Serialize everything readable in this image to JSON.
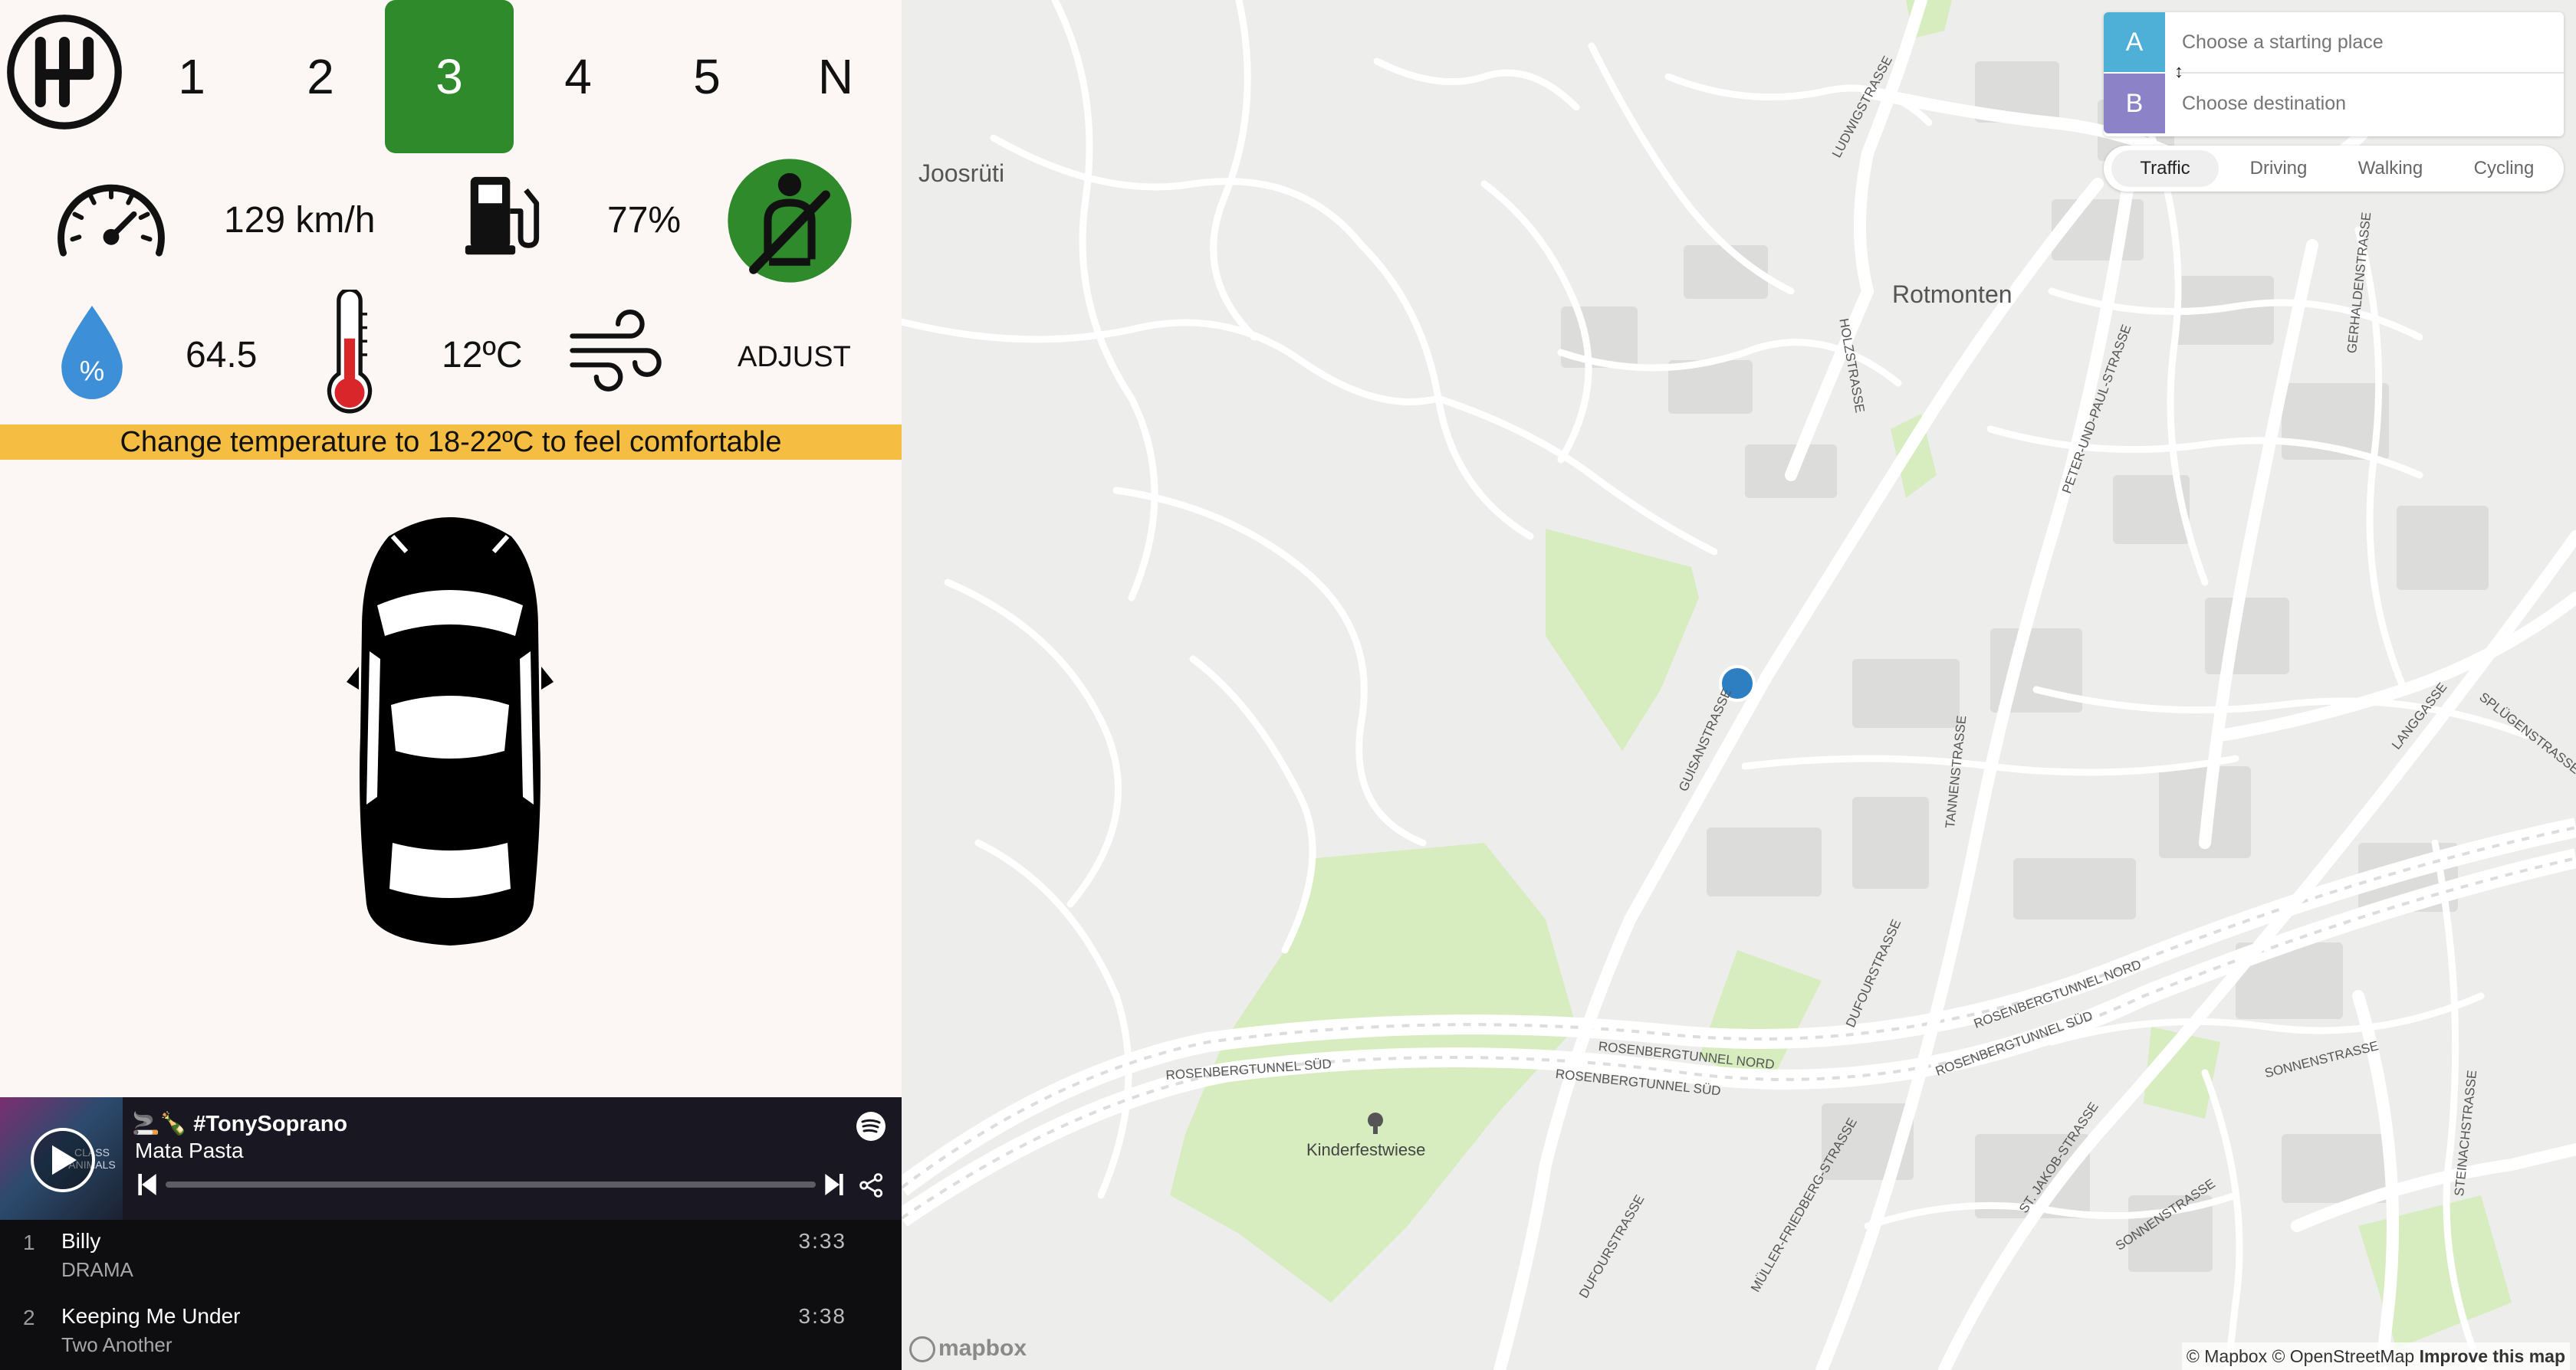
{
  "dashboard": {
    "gears": [
      "1",
      "2",
      "3",
      "4",
      "5",
      "N"
    ],
    "active_gear": "3",
    "speed": "129 km/h",
    "fuel": "77%",
    "humidity": "64.5",
    "humidity_symbol": "%",
    "temperature": "12ºC",
    "fan_action": "ADJUST",
    "banner": "Change temperature to 18-22ºC to feel comfortable",
    "colors": {
      "accent_green": "#2e8a2a",
      "banner_yellow": "#f5be42",
      "water_blue": "#3d8fd8",
      "thermo_red": "#d8262b"
    }
  },
  "player": {
    "artist": "#TonySopranо",
    "artist_emoji": "🚬🍾",
    "song": "Mata Pasta",
    "album_art_text": "CLASS ANIMALS",
    "tracks": [
      {
        "num": "1",
        "title": "Billy",
        "artist": "DRAMA",
        "duration": "3:33"
      },
      {
        "num": "2",
        "title": "Keeping Me Under",
        "artist": "Two Another",
        "duration": "3:38"
      }
    ]
  },
  "map": {
    "directions": {
      "a_label": "A",
      "b_label": "B",
      "origin_placeholder": "Choose a starting place",
      "destination_placeholder": "Choose destination",
      "swap_icon": "↕"
    },
    "profiles": [
      "Traffic",
      "Driving",
      "Walking",
      "Cycling"
    ],
    "active_profile": "Traffic",
    "labels": {
      "joosruti": "Joosrüti",
      "rotmonten": "Rotmonten",
      "kinderfestwiese": "Kinderfestwiese",
      "ludwigstrasse": "LUDWIGSTRASSE",
      "holzstrasse": "HOLZSTRASSE",
      "guisanstrasse": "GUISANSTRASSE",
      "tannenstrasse": "TANNENSTRASSE",
      "peter_paul": "PETER-UND-PAUL-STRASSE",
      "gerhaldenstrasse": "GERHALDENSTRASSE",
      "langgasse": "LANGGASSE",
      "splugenstrasse": "SPLÜGENSTRASSE",
      "dufourstrasse": "DUFOURSTRASSE",
      "dufourstrasse2": "DUFOURSTRASSE",
      "rosen_sud1": "ROSENBERGTUNNEL SÜD",
      "rosen_nord1": "ROSENBERGTUNNEL NORD",
      "rosen_sud2": "ROSENBERGTUNNEL SÜD",
      "rosen_nord2": "ROSENBERGTUNNEL NORD",
      "rosen_sud3": "ROSENBERGTUNNEL SÜD",
      "muller": "MÜLLER-FRIEDBERG-STRASSE",
      "stjakob": "ST. JAKOB-STRASSE",
      "sonnenstrasse1": "SONNENSTRASSE",
      "sonnenstrasse2": "SONNENSTRASSE",
      "steinachstrasse": "STEINACHSTRASSE"
    },
    "logo": "mapbox",
    "attribution": "© Mapbox © OpenStreetMap",
    "improve_link": "Improve this map"
  }
}
